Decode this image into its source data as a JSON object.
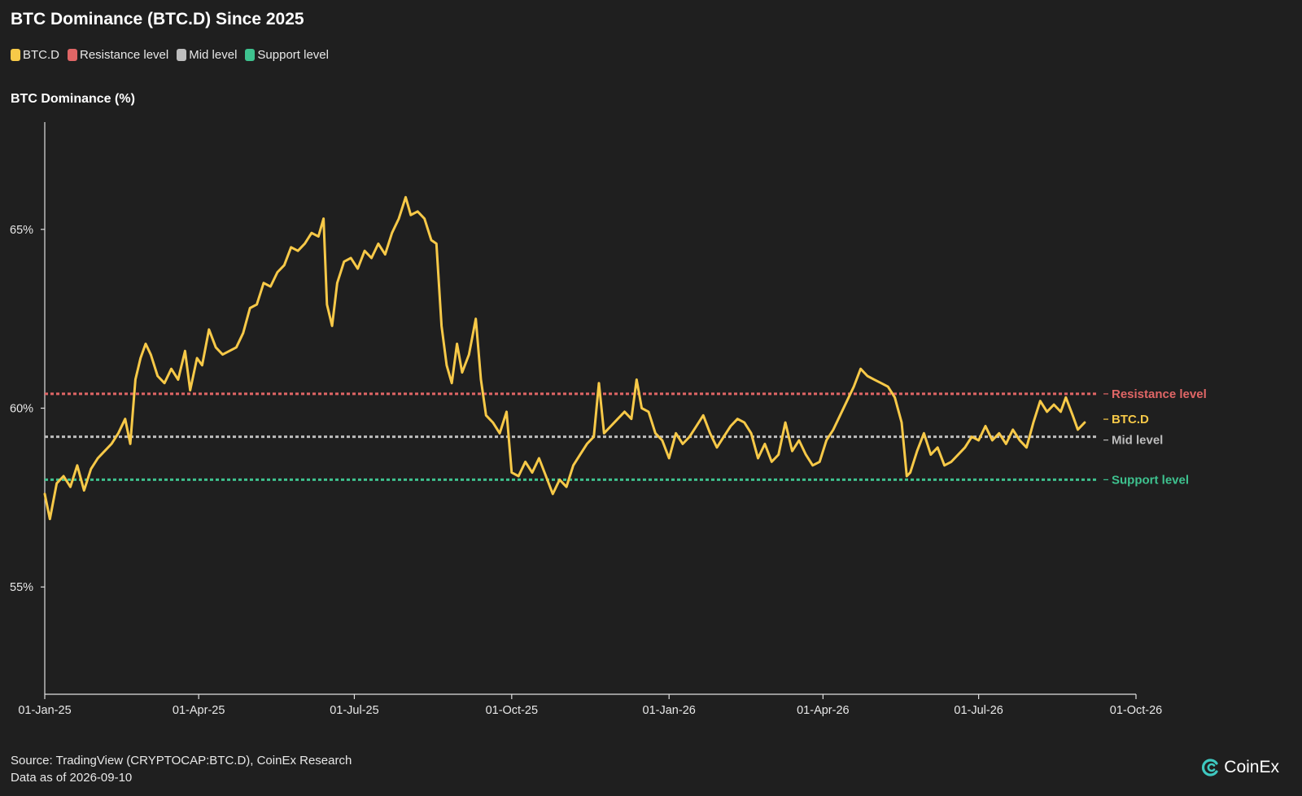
{
  "title": "BTC Dominance (BTC.D) Since 2025",
  "legend": [
    {
      "label": "BTC.D",
      "color": "#f7c948"
    },
    {
      "label": "Resistance level",
      "color": "#e06666"
    },
    {
      "label": "Mid level",
      "color": "#bdbdbd"
    },
    {
      "label": "Support level",
      "color": "#3ec28f"
    }
  ],
  "source_line": "Source: TradingView (CRYPTOCAP:BTC.D), CoinEx Research",
  "data_as_of": "Data as of 2026-09-10",
  "brand": {
    "name": "CoinEx",
    "icon": "coinex-logo-icon"
  },
  "chart_data": {
    "type": "line",
    "title": "BTC Dominance (BTC.D) Since 2025",
    "xlabel": "",
    "ylabel": "BTC Dominance (%)",
    "ylim": [
      52,
      68
    ],
    "xlim": [
      "2025-01-01",
      "2026-10-01"
    ],
    "grid": false,
    "legend_position": "top-left",
    "y_ticks": [
      {
        "value": 55,
        "label": "55%"
      },
      {
        "value": 60,
        "label": "60%"
      },
      {
        "value": 65,
        "label": "65%"
      }
    ],
    "x_ticks": [
      {
        "date": "2025-01-01",
        "label": "01-Jan-25"
      },
      {
        "date": "2025-04-01",
        "label": "01-Apr-25"
      },
      {
        "date": "2025-07-01",
        "label": "01-Jul-25"
      },
      {
        "date": "2025-10-01",
        "label": "01-Oct-25"
      },
      {
        "date": "2026-01-01",
        "label": "01-Jan-26"
      },
      {
        "date": "2026-04-01",
        "label": "01-Apr-26"
      },
      {
        "date": "2026-07-01",
        "label": "01-Jul-26"
      },
      {
        "date": "2026-10-01",
        "label": "01-Oct-26"
      }
    ],
    "reference_lines": [
      {
        "name": "Resistance level",
        "value": 60.4,
        "color": "#e06666"
      },
      {
        "name": "Mid level",
        "value": 59.2,
        "color": "#bdbdbd"
      },
      {
        "name": "Support level",
        "value": 58.0,
        "color": "#3ec28f"
      }
    ],
    "series": [
      {
        "name": "BTC.D",
        "color": "#f7c948",
        "points": [
          [
            "2025-01-01",
            57.6
          ],
          [
            "2025-01-04",
            56.9
          ],
          [
            "2025-01-08",
            57.9
          ],
          [
            "2025-01-12",
            58.1
          ],
          [
            "2025-01-16",
            57.8
          ],
          [
            "2025-01-20",
            58.4
          ],
          [
            "2025-01-24",
            57.7
          ],
          [
            "2025-01-28",
            58.3
          ],
          [
            "2025-02-01",
            58.6
          ],
          [
            "2025-02-05",
            58.8
          ],
          [
            "2025-02-09",
            59.0
          ],
          [
            "2025-02-13",
            59.3
          ],
          [
            "2025-02-17",
            59.7
          ],
          [
            "2025-02-20",
            59.0
          ],
          [
            "2025-02-23",
            60.8
          ],
          [
            "2025-02-26",
            61.4
          ],
          [
            "2025-03-01",
            61.8
          ],
          [
            "2025-03-04",
            61.5
          ],
          [
            "2025-03-08",
            60.9
          ],
          [
            "2025-03-12",
            60.7
          ],
          [
            "2025-03-16",
            61.1
          ],
          [
            "2025-03-20",
            60.8
          ],
          [
            "2025-03-24",
            61.6
          ],
          [
            "2025-03-27",
            60.5
          ],
          [
            "2025-03-31",
            61.4
          ],
          [
            "2025-04-03",
            61.2
          ],
          [
            "2025-04-07",
            62.2
          ],
          [
            "2025-04-11",
            61.7
          ],
          [
            "2025-04-15",
            61.5
          ],
          [
            "2025-04-19",
            61.6
          ],
          [
            "2025-04-23",
            61.7
          ],
          [
            "2025-04-27",
            62.1
          ],
          [
            "2025-05-01",
            62.8
          ],
          [
            "2025-05-05",
            62.9
          ],
          [
            "2025-05-09",
            63.5
          ],
          [
            "2025-05-13",
            63.4
          ],
          [
            "2025-05-17",
            63.8
          ],
          [
            "2025-05-21",
            64.0
          ],
          [
            "2025-05-25",
            64.5
          ],
          [
            "2025-05-29",
            64.4
          ],
          [
            "2025-06-02",
            64.6
          ],
          [
            "2025-06-06",
            64.9
          ],
          [
            "2025-06-10",
            64.8
          ],
          [
            "2025-06-13",
            65.3
          ],
          [
            "2025-06-15",
            62.9
          ],
          [
            "2025-06-18",
            62.3
          ],
          [
            "2025-06-21",
            63.5
          ],
          [
            "2025-06-25",
            64.1
          ],
          [
            "2025-06-29",
            64.2
          ],
          [
            "2025-07-03",
            63.9
          ],
          [
            "2025-07-07",
            64.4
          ],
          [
            "2025-07-11",
            64.2
          ],
          [
            "2025-07-15",
            64.6
          ],
          [
            "2025-07-19",
            64.3
          ],
          [
            "2025-07-23",
            64.9
          ],
          [
            "2025-07-27",
            65.3
          ],
          [
            "2025-07-31",
            65.9
          ],
          [
            "2025-08-03",
            65.4
          ],
          [
            "2025-08-07",
            65.5
          ],
          [
            "2025-08-11",
            65.3
          ],
          [
            "2025-08-15",
            64.7
          ],
          [
            "2025-08-18",
            64.6
          ],
          [
            "2025-08-21",
            62.3
          ],
          [
            "2025-08-24",
            61.2
          ],
          [
            "2025-08-27",
            60.7
          ],
          [
            "2025-08-30",
            61.8
          ],
          [
            "2025-09-02",
            61.0
          ],
          [
            "2025-09-06",
            61.5
          ],
          [
            "2025-09-10",
            62.5
          ],
          [
            "2025-09-13",
            60.8
          ],
          [
            "2025-09-16",
            59.8
          ],
          [
            "2025-09-20",
            59.6
          ],
          [
            "2025-09-24",
            59.3
          ],
          [
            "2025-09-28",
            59.9
          ],
          [
            "2025-10-01",
            58.2
          ],
          [
            "2025-10-05",
            58.1
          ],
          [
            "2025-10-09",
            58.5
          ],
          [
            "2025-10-13",
            58.2
          ],
          [
            "2025-10-17",
            58.6
          ],
          [
            "2025-10-21",
            58.1
          ],
          [
            "2025-10-25",
            57.6
          ],
          [
            "2025-10-29",
            58.0
          ],
          [
            "2025-11-02",
            57.8
          ],
          [
            "2025-11-06",
            58.4
          ],
          [
            "2025-11-10",
            58.7
          ],
          [
            "2025-11-14",
            59.0
          ],
          [
            "2025-11-18",
            59.2
          ],
          [
            "2025-11-21",
            60.7
          ],
          [
            "2025-11-24",
            59.3
          ],
          [
            "2025-11-28",
            59.5
          ],
          [
            "2025-12-02",
            59.7
          ],
          [
            "2025-12-06",
            59.9
          ],
          [
            "2025-12-10",
            59.7
          ],
          [
            "2025-12-13",
            60.8
          ],
          [
            "2025-12-16",
            60.0
          ],
          [
            "2025-12-20",
            59.9
          ],
          [
            "2025-12-24",
            59.3
          ],
          [
            "2025-12-28",
            59.1
          ],
          [
            "2026-01-01",
            58.6
          ],
          [
            "2026-01-05",
            59.3
          ],
          [
            "2026-01-09",
            59.0
          ],
          [
            "2026-01-13",
            59.2
          ],
          [
            "2026-01-17",
            59.5
          ],
          [
            "2026-01-21",
            59.8
          ],
          [
            "2026-01-25",
            59.3
          ],
          [
            "2026-01-29",
            58.9
          ],
          [
            "2026-02-02",
            59.2
          ],
          [
            "2026-02-06",
            59.5
          ],
          [
            "2026-02-10",
            59.7
          ],
          [
            "2026-02-14",
            59.6
          ],
          [
            "2026-02-18",
            59.3
          ],
          [
            "2026-02-22",
            58.6
          ],
          [
            "2026-02-26",
            59.0
          ],
          [
            "2026-03-02",
            58.5
          ],
          [
            "2026-03-06",
            58.7
          ],
          [
            "2026-03-10",
            59.6
          ],
          [
            "2026-03-14",
            58.8
          ],
          [
            "2026-03-18",
            59.1
          ],
          [
            "2026-03-22",
            58.7
          ],
          [
            "2026-03-26",
            58.4
          ],
          [
            "2026-03-30",
            58.5
          ],
          [
            "2026-04-03",
            59.1
          ],
          [
            "2026-04-07",
            59.4
          ],
          [
            "2026-04-11",
            59.8
          ],
          [
            "2026-04-15",
            60.2
          ],
          [
            "2026-04-19",
            60.6
          ],
          [
            "2026-04-23",
            61.1
          ],
          [
            "2026-04-27",
            60.9
          ],
          [
            "2026-05-01",
            60.8
          ],
          [
            "2026-05-05",
            60.7
          ],
          [
            "2026-05-09",
            60.6
          ],
          [
            "2026-05-13",
            60.3
          ],
          [
            "2026-05-17",
            59.6
          ],
          [
            "2026-05-20",
            58.1
          ],
          [
            "2026-05-22",
            58.2
          ],
          [
            "2026-05-26",
            58.8
          ],
          [
            "2026-05-30",
            59.3
          ],
          [
            "2026-06-03",
            58.7
          ],
          [
            "2026-06-07",
            58.9
          ],
          [
            "2026-06-11",
            58.4
          ],
          [
            "2026-06-15",
            58.5
          ],
          [
            "2026-06-19",
            58.7
          ],
          [
            "2026-06-23",
            58.9
          ],
          [
            "2026-06-27",
            59.2
          ],
          [
            "2026-07-01",
            59.1
          ],
          [
            "2026-07-05",
            59.5
          ],
          [
            "2026-07-09",
            59.1
          ],
          [
            "2026-07-13",
            59.3
          ],
          [
            "2026-07-17",
            59.0
          ],
          [
            "2026-07-21",
            59.4
          ],
          [
            "2026-07-25",
            59.1
          ],
          [
            "2026-07-29",
            58.9
          ],
          [
            "2026-08-02",
            59.6
          ],
          [
            "2026-08-06",
            60.2
          ],
          [
            "2026-08-10",
            59.9
          ],
          [
            "2026-08-14",
            60.1
          ],
          [
            "2026-08-18",
            59.9
          ],
          [
            "2026-08-21",
            60.3
          ],
          [
            "2026-08-25",
            59.8
          ],
          [
            "2026-08-28",
            59.4
          ],
          [
            "2026-09-01",
            59.6
          ]
        ]
      }
    ]
  }
}
